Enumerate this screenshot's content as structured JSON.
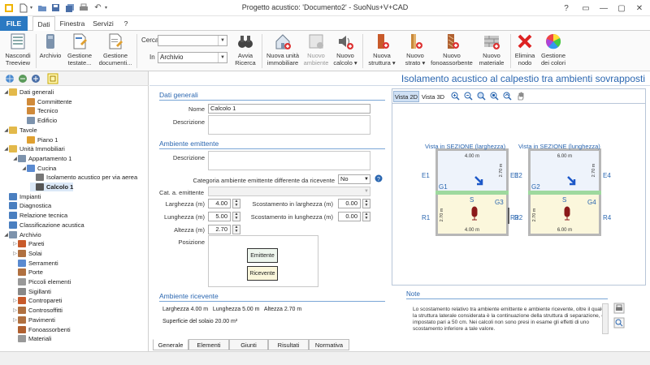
{
  "window": {
    "title": "Progetto acustico: 'Documento2' - SuoNus+V+CAD"
  },
  "ribbon_tabs": [
    "FILE",
    "Dati",
    "Finestra",
    "Servizi",
    "?"
  ],
  "ribbon": {
    "nascondi": "Nascondi\nTreeview",
    "archivio": "Archivio",
    "gestione_testate": "Gestione\ntestate...",
    "gestione_documenti": "Gestione\ndocumenti...",
    "cerca_label": "Cerca",
    "cerca_value": "",
    "in_label": "In",
    "in_value": "Archivio",
    "avvia": "Avvia\nRicerca",
    "nuova_unita": "Nuova unità\nimmobiliare",
    "nuovo_ambiente": "Nuovo\nambiente",
    "nuovo_calcolo": "Nuovo\ncalcolo ▾",
    "nuova_struttura": "Nuova\nstruttura ▾",
    "nuovo_strato": "Nuovo\nstrato ▾",
    "nuovo_fono": "Nuovo\nfonoassorbente",
    "nuovo_materiale": "Nuovo\nmateriale",
    "elimina": "Elimina\nnodo",
    "colori": "Gestione\ndei colori"
  },
  "tree": [
    {
      "label": "Dati generali",
      "level": 0,
      "exp": "◢",
      "icon": "folder-icon"
    },
    {
      "label": "Committente",
      "level": 2,
      "exp": "",
      "icon": "person-icon"
    },
    {
      "label": "Tecnico",
      "level": 2,
      "exp": "",
      "icon": "person-icon"
    },
    {
      "label": "Edificio",
      "level": 2,
      "exp": "",
      "icon": "building-icon"
    },
    {
      "label": "Tavole",
      "level": 0,
      "exp": "◢",
      "icon": "folder-icon"
    },
    {
      "label": "Piano 1",
      "level": 2,
      "exp": "",
      "icon": "pencil-icon"
    },
    {
      "label": "Unità Immobiliari",
      "level": 0,
      "exp": "◢",
      "icon": "folder-icon"
    },
    {
      "label": "Appartamento 1",
      "level": 1,
      "exp": "◢",
      "icon": "house-icon"
    },
    {
      "label": "Cucina",
      "level": 2,
      "exp": "◢",
      "icon": "room-icon"
    },
    {
      "label": "Isolamento acustico per via aerea",
      "level": 3,
      "exp": "",
      "icon": "speaker-icon"
    },
    {
      "label": "Calcolo 1",
      "level": 3,
      "exp": "",
      "icon": "footstep-icon",
      "selected": true
    },
    {
      "label": "Impianti",
      "level": 0,
      "exp": "",
      "icon": "pipes-icon"
    },
    {
      "label": "Diagnostica",
      "level": 0,
      "exp": "",
      "icon": "diagnostic-icon"
    },
    {
      "label": "Relazione tecnica",
      "level": 0,
      "exp": "",
      "icon": "report-icon"
    },
    {
      "label": "Classificazione acustica",
      "level": 0,
      "exp": "",
      "icon": "report-icon"
    },
    {
      "label": "Archivio",
      "level": 0,
      "exp": "◢",
      "icon": "archive-icon"
    },
    {
      "label": "Pareti",
      "level": 1,
      "exp": "▷",
      "icon": "wall-icon"
    },
    {
      "label": "Solai",
      "level": 1,
      "exp": "▷",
      "icon": "slab-icon"
    },
    {
      "label": "Serramenti",
      "level": 1,
      "exp": "",
      "icon": "window-icon"
    },
    {
      "label": "Porte",
      "level": 1,
      "exp": "",
      "icon": "door-icon"
    },
    {
      "label": "Piccoli elementi",
      "level": 1,
      "exp": "",
      "icon": "element-icon"
    },
    {
      "label": "Sigillanti",
      "level": 1,
      "exp": "",
      "icon": "sealant-icon"
    },
    {
      "label": "Contropareti",
      "level": 1,
      "exp": "▷",
      "icon": "wall-icon"
    },
    {
      "label": "Controsoffitti",
      "level": 1,
      "exp": "▷",
      "icon": "ceiling-icon"
    },
    {
      "label": "Pavimenti",
      "level": 1,
      "exp": "▷",
      "icon": "floor-icon"
    },
    {
      "label": "Fonoassorbenti",
      "level": 1,
      "exp": "",
      "icon": "absorber-icon"
    },
    {
      "label": "Materiali",
      "level": 1,
      "exp": "",
      "icon": "material-icon"
    }
  ],
  "header_title": "Isolamento acustico al calpestio tra ambienti sovrapposti",
  "form": {
    "dati_generali": "Dati generali",
    "nome_label": "Nome",
    "nome_value": "Calcolo 1",
    "descrizione_label": "Descrizione",
    "ambiente_emittente": "Ambiente emittente",
    "descrizione2_label": "Descrizione",
    "categoria_label": "Categoria ambiente emittente differente da ricevente",
    "categoria_value": "No",
    "cat_label": "Cat. a. emittente",
    "larghezza_label": "Larghezza (m)",
    "larghezza_value": "4.00",
    "lunghezza_label": "Lunghezza (m)",
    "lunghezza_value": "5.00",
    "altezza_label": "Altezza (m)",
    "altezza_value": "2.70",
    "scost_larg_label": "Scostamento in larghezza (m)",
    "scost_larg_value": "0.00",
    "scost_lung_label": "Scostamento in lunghezza (m)",
    "scost_lung_value": "0.00",
    "posizione_label": "Posizione",
    "emittente_btn": "Emittente",
    "ricevente_btn": "Ricevente",
    "ambiente_ricevente": "Ambiente ricevente",
    "ricevente_dims": "Larghezza 4.00 m   Lunghezza 5.00 m   Altezza 2.70 m",
    "superficie": "Superficie del solaio 20.00 m²"
  },
  "view": {
    "tab_2d": "Vista 2D",
    "tab_3d": "Vista 3D",
    "sez_larg": "Vista in SEZIONE (larghezza)",
    "sez_lung": "Vista in SEZIONE (lunghezza)",
    "left": {
      "top_dim": "4.00 m",
      "bot_dim": "4.00 m",
      "h_top": "2.70 m",
      "h_bot": "2.70 m",
      "e1": "E1",
      "e3": "E3",
      "r1": "R1",
      "r3": "R3",
      "g1": "G1",
      "g3": "G3",
      "s": "S"
    },
    "right": {
      "top_dim": "6.00 m",
      "bot_dim": "6.00 m",
      "h_top": "2.70 m",
      "h_bot": "2.70 m",
      "e1": "E2",
      "e3": "E4",
      "r1": "R2",
      "r3": "R4",
      "g1": "G2",
      "g3": "G4",
      "s": "S"
    }
  },
  "notes": {
    "title": "Note",
    "text": "Lo scostamento relativo tra ambiente emittente e ambiente ricevente, oltre il quale la struttura laterale considerata è la continuazione della struttura di separazione, è impostato pari a 50 cm. Nei calcoli non sono presi in esame gli effetti di uno scostamento inferiore a tale valore."
  },
  "bottom_tabs": [
    "Generale",
    "Elementi",
    "Giunti",
    "Risultati",
    "Normativa"
  ],
  "colors": {
    "accent": "#2a66b0",
    "file_tab": "#2b79c2",
    "emit_fill": "#eef3fb",
    "recv_fill": "#fbf7dc",
    "slab": "#9ed99e"
  }
}
